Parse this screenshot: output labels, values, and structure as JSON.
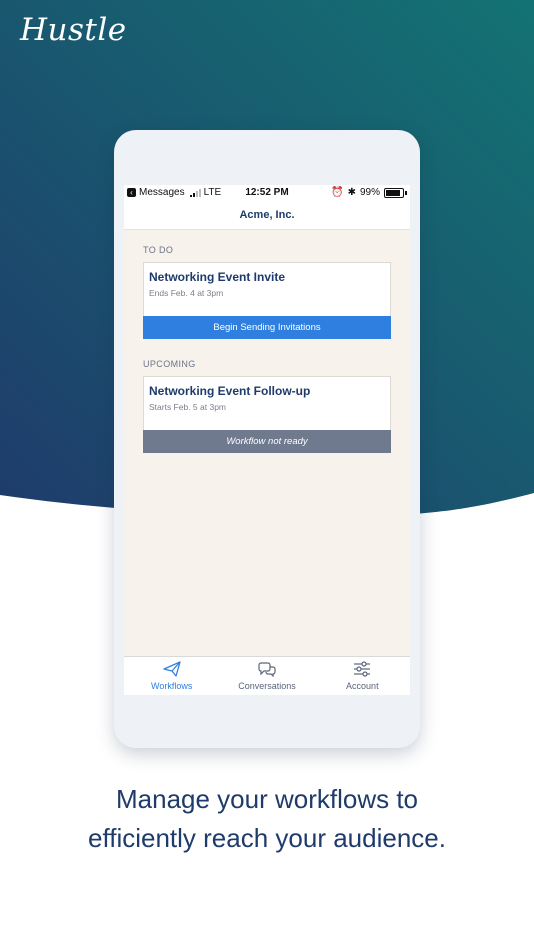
{
  "brand": {
    "name": "Hustle"
  },
  "status_bar": {
    "back_app": "Messages",
    "carrier": "LTE",
    "time": "12:52 PM",
    "battery": "99%"
  },
  "nav": {
    "title": "Acme, Inc."
  },
  "todo": {
    "label": "TO DO",
    "card": {
      "title": "Networking Event Invite",
      "subtitle": "Ends Feb. 4 at 3pm",
      "action": "Begin Sending Invitations"
    }
  },
  "upcoming": {
    "label": "UPCOMING",
    "card": {
      "title": "Networking Event Follow-up",
      "subtitle": "Starts Feb. 5 at 3pm",
      "action": "Workflow not ready"
    }
  },
  "tabs": [
    {
      "label": "Workflows",
      "icon": "paper-plane-icon",
      "active": true
    },
    {
      "label": "Conversations",
      "icon": "chat-bubbles-icon",
      "active": false
    },
    {
      "label": "Account",
      "icon": "sliders-icon",
      "active": false
    }
  ],
  "tagline": {
    "line1": "Manage your workflows to",
    "line2": "efficiently reach your audience."
  },
  "colors": {
    "gradient_start": "#1f3b6b",
    "gradient_end": "#137373",
    "primary_blue": "#2f7fe0",
    "disabled_gray": "#6f7a8f",
    "navy_text": "#1f3b6b"
  }
}
